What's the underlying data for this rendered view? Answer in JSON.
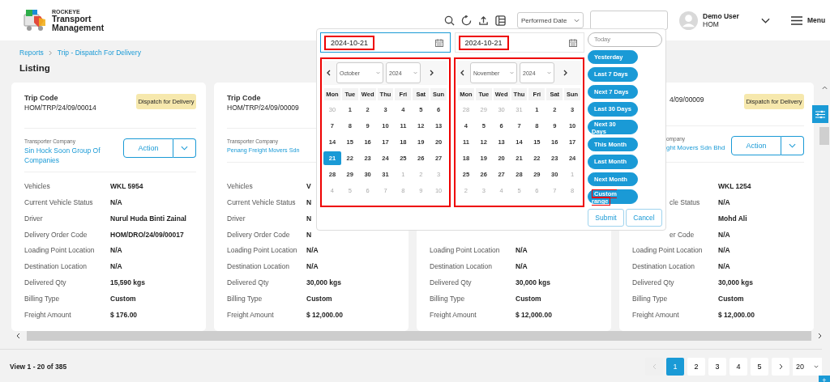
{
  "header": {
    "brand": "ROCKEYE",
    "app_name": "Transport Management",
    "date_filter": "Performed Date",
    "user": {
      "name": "Demo User",
      "org": "HOM"
    },
    "menu_label": "Menu"
  },
  "breadcrumb": [
    "Reports",
    "Trip - Dispatch For Delivery"
  ],
  "page_title": "Listing",
  "cards": [
    {
      "trip_code_label": "Trip Code",
      "trip_code": "HOM/TRP/24/09/00014",
      "status": "Dispatch for Delivery",
      "transporter_label": "Transporter Company",
      "transporter": "Sin Hock Soon Group Of Companies",
      "action": "Action",
      "rows": [
        {
          "label": "Vehicles",
          "value": "WKL 5954"
        },
        {
          "label": "Current Vehicle Status",
          "value": "N/A"
        },
        {
          "label": "Driver",
          "value": "Nurul Huda Binti Zainal"
        },
        {
          "label": "Delivery Order Code",
          "value": "HOM/DRO/24/09/00017"
        },
        {
          "label": "Loading Point Location",
          "value": "N/A"
        },
        {
          "label": "Destination Location",
          "value": "N/A"
        },
        {
          "label": "Delivered Qty",
          "value": "15,590 kgs"
        },
        {
          "label": "Billing Type",
          "value": "Custom"
        },
        {
          "label": "Freight Amount",
          "value": "$ 176.00"
        }
      ]
    },
    {
      "trip_code_label": "Trip Code",
      "trip_code": "HOM/TRP/24/09/00009",
      "transporter_label": "Transporter Company",
      "transporter": "Penang Freight Movers Sdn",
      "rows": [
        {
          "label": "Vehicles",
          "value": "V"
        },
        {
          "label": "Current Vehicle Status",
          "value": "N"
        },
        {
          "label": "Driver",
          "value": "N"
        },
        {
          "label": "Delivery Order Code",
          "value": "N"
        },
        {
          "label": "Loading Point Location",
          "value": "N/A"
        },
        {
          "label": "Destination Location",
          "value": "N/A"
        },
        {
          "label": "Delivered Qty",
          "value": "30,000 kgs"
        },
        {
          "label": "Billing Type",
          "value": "Custom"
        },
        {
          "label": "Freight Amount",
          "value": "$ 12,000.00"
        }
      ]
    },
    {
      "rows": [
        {
          "label": "Loading Point Location",
          "value": "N/A"
        },
        {
          "label": "Destination Location",
          "value": "N/A"
        },
        {
          "label": "Delivered Qty",
          "value": "30,000 kgs"
        },
        {
          "label": "Billing Type",
          "value": "Custom"
        },
        {
          "label": "Freight Amount",
          "value": "$ 12,000.00"
        }
      ]
    },
    {
      "trip_code": "4/09/00009",
      "status": "Dispatch for Delivery",
      "transporter_label": "ompany",
      "transporter": "ght Movers Sdn Bhd",
      "action": "Action",
      "rows": [
        {
          "value": "WKL 1254"
        },
        {
          "label": "cle Status",
          "value": "N/A"
        },
        {
          "value": "Mohd Ali"
        },
        {
          "label": "er Code",
          "value": "N/A"
        },
        {
          "label": "Loading Point Location",
          "value": "N/A"
        },
        {
          "label": "Destination Location",
          "value": "N/A"
        },
        {
          "label": "Delivered Qty",
          "value": "30,000 kgs"
        },
        {
          "label": "Billing Type",
          "value": "Custom"
        },
        {
          "label": "Freight Amount",
          "value": "$ 12,000.00"
        }
      ]
    }
  ],
  "date_picker": {
    "start_date": {
      "value": "2024-10-21",
      "focused": true,
      "highlighted": true
    },
    "end_date": {
      "value": "2024-10-21",
      "focused": false,
      "highlighted": true
    },
    "calendars": [
      {
        "month": "October",
        "year": "2024",
        "highlighted": true,
        "weekdays": [
          "Mon",
          "Tue",
          "Wed",
          "Thu",
          "Fri",
          "Sat",
          "Sun"
        ],
        "weeks": [
          [
            {
              "day": "30",
              "other_month": true,
              "selected": false
            },
            {
              "day": "1",
              "other_month": false,
              "selected": false
            },
            {
              "day": "2",
              "other_month": false,
              "selected": false
            },
            {
              "day": "3",
              "other_month": false,
              "selected": false
            },
            {
              "day": "4",
              "other_month": false,
              "selected": false
            },
            {
              "day": "5",
              "other_month": false,
              "selected": false
            },
            {
              "day": "6",
              "other_month": false,
              "selected": false
            }
          ],
          [
            {
              "day": "7",
              "other_month": false,
              "selected": false
            },
            {
              "day": "8",
              "other_month": false,
              "selected": false
            },
            {
              "day": "9",
              "other_month": false,
              "selected": false
            },
            {
              "day": "10",
              "other_month": false,
              "selected": false
            },
            {
              "day": "11",
              "other_month": false,
              "selected": false
            },
            {
              "day": "12",
              "other_month": false,
              "selected": false
            },
            {
              "day": "13",
              "other_month": false,
              "selected": false
            }
          ],
          [
            {
              "day": "14",
              "other_month": false,
              "selected": false
            },
            {
              "day": "15",
              "other_month": false,
              "selected": false
            },
            {
              "day": "16",
              "other_month": false,
              "selected": false
            },
            {
              "day": "17",
              "other_month": false,
              "selected": false
            },
            {
              "day": "18",
              "other_month": false,
              "selected": false
            },
            {
              "day": "19",
              "other_month": false,
              "selected": false
            },
            {
              "day": "20",
              "other_month": false,
              "selected": false
            }
          ],
          [
            {
              "day": "21",
              "other_month": false,
              "selected": true
            },
            {
              "day": "22",
              "other_month": false,
              "selected": false
            },
            {
              "day": "23",
              "other_month": false,
              "selected": false
            },
            {
              "day": "24",
              "other_month": false,
              "selected": false
            },
            {
              "day": "25",
              "other_month": false,
              "selected": false
            },
            {
              "day": "26",
              "other_month": false,
              "selected": false
            },
            {
              "day": "27",
              "other_month": false,
              "selected": false
            }
          ],
          [
            {
              "day": "28",
              "other_month": false,
              "selected": false
            },
            {
              "day": "29",
              "other_month": false,
              "selected": false
            },
            {
              "day": "30",
              "other_month": false,
              "selected": false
            },
            {
              "day": "31",
              "other_month": false,
              "selected": false
            },
            {
              "day": "1",
              "other_month": true,
              "selected": false
            },
            {
              "day": "2",
              "other_month": true,
              "selected": false
            },
            {
              "day": "3",
              "other_month": true,
              "selected": false
            }
          ],
          [
            {
              "day": "4",
              "other_month": true,
              "selected": false
            },
            {
              "day": "5",
              "other_month": true,
              "selected": false
            },
            {
              "day": "6",
              "other_month": true,
              "selected": false
            },
            {
              "day": "7",
              "other_month": true,
              "selected": false
            },
            {
              "day": "8",
              "other_month": true,
              "selected": false
            },
            {
              "day": "9",
              "other_month": true,
              "selected": false
            },
            {
              "day": "10",
              "other_month": true,
              "selected": false
            }
          ]
        ]
      },
      {
        "month": "November",
        "year": "2024",
        "highlighted": true,
        "weekdays": [
          "Mon",
          "Tue",
          "Wed",
          "Thu",
          "Fri",
          "Sat",
          "Sun"
        ],
        "weeks": [
          [
            {
              "day": "28",
              "other_month": true,
              "selected": false
            },
            {
              "day": "29",
              "other_month": true,
              "selected": false
            },
            {
              "day": "30",
              "other_month": true,
              "selected": false
            },
            {
              "day": "31",
              "other_month": true,
              "selected": false
            },
            {
              "day": "1",
              "other_month": false,
              "selected": false
            },
            {
              "day": "2",
              "other_month": false,
              "selected": false
            },
            {
              "day": "3",
              "other_month": false,
              "selected": false
            }
          ],
          [
            {
              "day": "4",
              "other_month": false,
              "selected": false
            },
            {
              "day": "5",
              "other_month": false,
              "selected": false
            },
            {
              "day": "6",
              "other_month": false,
              "selected": false
            },
            {
              "day": "7",
              "other_month": false,
              "selected": false
            },
            {
              "day": "8",
              "other_month": false,
              "selected": false
            },
            {
              "day": "9",
              "other_month": false,
              "selected": false
            },
            {
              "day": "10",
              "other_month": false,
              "selected": false
            }
          ],
          [
            {
              "day": "11",
              "other_month": false,
              "selected": false
            },
            {
              "day": "12",
              "other_month": false,
              "selected": false
            },
            {
              "day": "13",
              "other_month": false,
              "selected": false
            },
            {
              "day": "14",
              "other_month": false,
              "selected": false
            },
            {
              "day": "15",
              "other_month": false,
              "selected": false
            },
            {
              "day": "16",
              "other_month": false,
              "selected": false
            },
            {
              "day": "17",
              "other_month": false,
              "selected": false
            }
          ],
          [
            {
              "day": "18",
              "other_month": false,
              "selected": false
            },
            {
              "day": "19",
              "other_month": false,
              "selected": false
            },
            {
              "day": "20",
              "other_month": false,
              "selected": false
            },
            {
              "day": "21",
              "other_month": false,
              "selected": false
            },
            {
              "day": "22",
              "other_month": false,
              "selected": false
            },
            {
              "day": "23",
              "other_month": false,
              "selected": false
            },
            {
              "day": "24",
              "other_month": false,
              "selected": false
            }
          ],
          [
            {
              "day": "25",
              "other_month": false,
              "selected": false
            },
            {
              "day": "26",
              "other_month": false,
              "selected": false
            },
            {
              "day": "27",
              "other_month": false,
              "selected": false
            },
            {
              "day": "28",
              "other_month": false,
              "selected": false
            },
            {
              "day": "29",
              "other_month": false,
              "selected": false
            },
            {
              "day": "30",
              "other_month": false,
              "selected": false
            },
            {
              "day": "1",
              "other_month": true,
              "selected": false
            }
          ],
          [
            {
              "day": "2",
              "other_month": true,
              "selected": false
            },
            {
              "day": "3",
              "other_month": true,
              "selected": false
            },
            {
              "day": "4",
              "other_month": true,
              "selected": false
            },
            {
              "day": "5",
              "other_month": true,
              "selected": false
            },
            {
              "day": "6",
              "other_month": true,
              "selected": false
            },
            {
              "day": "7",
              "other_month": true,
              "selected": false
            },
            {
              "day": "8",
              "other_month": true,
              "selected": false
            }
          ]
        ]
      }
    ],
    "ranges": [
      {
        "label": "Today",
        "active": false,
        "highlighted": false
      },
      {
        "label": "Yesterday",
        "active": true,
        "highlighted": false
      },
      {
        "label": "Last 7 Days",
        "active": true,
        "highlighted": false
      },
      {
        "label": "Next 7 Days",
        "active": true,
        "highlighted": false
      },
      {
        "label": "Last 30 Days",
        "active": true,
        "highlighted": false
      },
      {
        "label": "Next 30 Days",
        "active": true,
        "highlighted": false
      },
      {
        "label": "This Month",
        "active": true,
        "highlighted": false
      },
      {
        "label": "Last Month",
        "active": true,
        "highlighted": false
      },
      {
        "label": "Next Month",
        "active": true,
        "highlighted": false
      },
      {
        "label": "Custom range",
        "active": true,
        "highlighted": true
      }
    ],
    "submit": "Submit",
    "cancel": "Cancel"
  },
  "footer": {
    "summary": "View 1 - 20 of 385",
    "prev_disabled": true,
    "pages": [
      {
        "label": "1",
        "selected": true
      },
      {
        "label": "2",
        "selected": false
      },
      {
        "label": "3",
        "selected": false
      },
      {
        "label": "4",
        "selected": false
      },
      {
        "label": "5",
        "selected": false
      }
    ],
    "page_size": "20",
    "add_button": "+"
  }
}
